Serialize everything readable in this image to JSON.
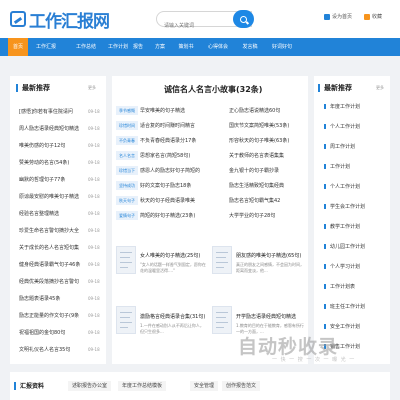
{
  "header": {
    "logo_text": "工作汇报网",
    "search_placeholder": "请输入关键词",
    "link_home": "设为首页",
    "link_fav": "收藏"
  },
  "nav": [
    "首页",
    "工作汇报",
    "工作总结",
    "工作计划",
    "报告",
    "方案",
    "策划书",
    "心得体会",
    "发言稿",
    "好词好句"
  ],
  "left": {
    "title": "最新推荐",
    "more": "更多",
    "items": [
      {
        "text": "[感悟]你若有事住院请问",
        "date": "09-18"
      },
      {
        "text": "周人励志语录经典短句精选",
        "date": "09-18"
      },
      {
        "text": "唯美伤感的句子12句",
        "date": "09-18"
      },
      {
        "text": "赞美劳动的名言(54条)",
        "date": "09-18"
      },
      {
        "text": "幽默的哲理句子77条",
        "date": "09-18"
      },
      {
        "text": "原谅最安慰的唯美句子精选",
        "date": "09-18"
      },
      {
        "text": "经验名言整理精选",
        "date": "09-18"
      },
      {
        "text": "珍爱生命名言警句摘抄大全",
        "date": "09-18"
      },
      {
        "text": "关于成长的名人名言短句集",
        "date": "09-18"
      },
      {
        "text": "健身经典语录霸气句子46条",
        "date": "09-18"
      },
      {
        "text": "经典优美段落摘抄名言警句",
        "date": "09-18"
      },
      {
        "text": "励志题表语录45条",
        "date": "09-18"
      },
      {
        "text": "励志正能量的作文句子(9条",
        "date": "09-18"
      },
      {
        "text": "祝福祖国的金句80句",
        "date": "09-18"
      },
      {
        "text": "文明礼仪名人名言35句",
        "date": "09-18"
      }
    ]
  },
  "center": {
    "title": "诚信名人名言小故事(32条)",
    "rows": [
      {
        "tag": "季节感慨",
        "text": "早安唯美的句子精选",
        "text2": "正心励志语说精选60句"
      },
      {
        "tag": "珍惜时间",
        "text": "适合复的时间赚时间精言",
        "text2": "国庆节文案简短唯美(53条)"
      },
      {
        "tag": "不负青春",
        "text": "不负青春经典语录分17条",
        "text2": "形容秋天的句子唯美(63条)"
      },
      {
        "tag": "名人名言",
        "text": "思想家名言(简短58句)",
        "text2": "关于教师的名言表语集集"
      },
      {
        "tag": "珍惜当下",
        "text": "感恩人的励志好句子简短的",
        "text2": "金九银十的句子霸抄录"
      },
      {
        "tag": "坚持成功",
        "text": "好的文案句子励志18条",
        "text2": "励志生活精致短句集经典"
      },
      {
        "tag": "秋天句子",
        "text": "秋天的句子经典语录唯美",
        "text2": "励志名言短句霸气集42"
      },
      {
        "tag": "爱情句子",
        "text": "简短的好句子精选(23条)",
        "text2": "大学学业的句子28句"
      }
    ],
    "cards": [
      {
        "title": "女人唯美的句子精选(25句)",
        "desc": "\"女人的话题一样香气到固定，愿你在花的温暖里活得....\""
      },
      {
        "title": "朋友感的唯美句子精选(65句)",
        "desc": "真正的朋友之间感情，不会因为时间，距离而变淡，他..."
      },
      {
        "title": "激励格言经典语录合集(31句)",
        "desc": "1.一件在感动别人从不再后让你人，但只生很多..."
      },
      {
        "title": "开学励志语录经典短句精选",
        "desc": "1.教育的目的在于能教育，感恩有所行一的一方面，..."
      }
    ]
  },
  "right": {
    "title": "最新推荐",
    "more": "更多",
    "items": [
      "年度工作计划",
      "个人工作计划",
      "周工作计划",
      "工作计划",
      "个人工作计划",
      "学生会工作计划",
      "教学工作计划",
      "幼儿园工作计划",
      "个人学习计划",
      "工作计划表",
      "班主任工作计划",
      "安全工作计划",
      "销售工作计划"
    ]
  },
  "footer": {
    "title": "汇报资料",
    "tabs": [
      "述职报告办公室",
      "年度工作总结模板",
      "安全管理",
      "创作报告范文"
    ]
  },
  "watermark": {
    "text": "自动秒收录",
    "sub": "一 快 一 搜 一 次 一 曝 光 一"
  },
  "colors": {
    "brand": "#2183d8",
    "active_tab": "#f7941d"
  }
}
